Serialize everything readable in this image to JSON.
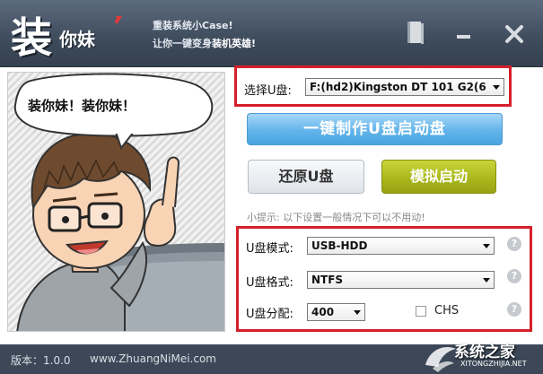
{
  "header": {
    "logo_main": "装",
    "logo_sub": "你妹",
    "slogan_line1": "重装系统小Case!",
    "slogan_line2_prefix": "让你一键变身",
    "slogan_line2_highlight": "装机英雄!"
  },
  "illustration": {
    "speech_bubble": "装你妹！装你妹！"
  },
  "usb_select": {
    "label": "选择U盘:",
    "value": "F:(hd2)Kingston DT 101 G2(6"
  },
  "actions": {
    "make_boot_label": "一键制作U盘启动盘",
    "restore_label": "还原U盘",
    "simulate_label": "模拟启动"
  },
  "tip": "小提示: 以下设置一般情况下可以不用动!",
  "settings": {
    "mode_label": "U盘模式:",
    "mode_value": "USB-HDD",
    "format_label": "U盘格式:",
    "format_value": "NTFS",
    "partition_label": "U盘分配:",
    "partition_value": "400",
    "chs_label": "CHS",
    "help_symbol": "?"
  },
  "footer": {
    "version": "版本：1.0.0",
    "website": "www.ZhuangNiMei.com"
  },
  "watermark": {
    "text": "系统之家",
    "url": "XITONGZHIJIA.NET"
  },
  "colors": {
    "titlebar": "#3e4b5c",
    "highlight_border": "#d5202b",
    "make_button": "#62b4ea",
    "simulate_button": "#a8b51b",
    "footer": "#3c4857"
  }
}
